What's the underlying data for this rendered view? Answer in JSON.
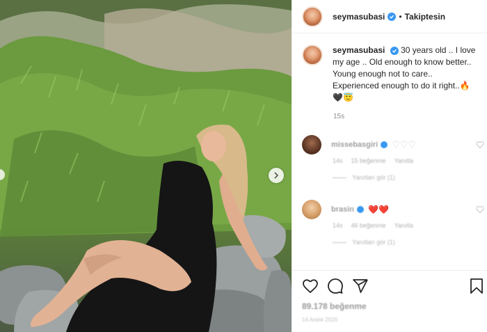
{
  "post": {
    "username": "seymasubasi",
    "follow_status": "Takiptesin",
    "caption_text": "30 years old .. I love my age .. Old enough to know better.. Young enough not to care.. Experienced enough to do it right..🔥🖤😇",
    "timestamp": "15s"
  },
  "comments": [
    {
      "username": "missebasgiri",
      "emojis": "♡♡♡",
      "age": "14s",
      "likes": "15 beğenme",
      "reply_label": "Yanıtla",
      "view_replies": "Yanıtları gör (1)"
    },
    {
      "username": "brasin",
      "emojis": "❤️❤️",
      "age": "14s",
      "likes": "46 beğenme",
      "reply_label": "Yanıtla",
      "view_replies": "Yanıtları gör (1)"
    }
  ],
  "footer": {
    "likes_text": "89.178 beğenme",
    "date_text": "14 Aralık 2020"
  },
  "colors": {
    "verified": "#3897f0",
    "heart": "#ed4956"
  },
  "icons": [
    "heart-icon",
    "comment-icon",
    "share-icon",
    "save-icon",
    "verified-icon",
    "chevron-right-icon"
  ]
}
